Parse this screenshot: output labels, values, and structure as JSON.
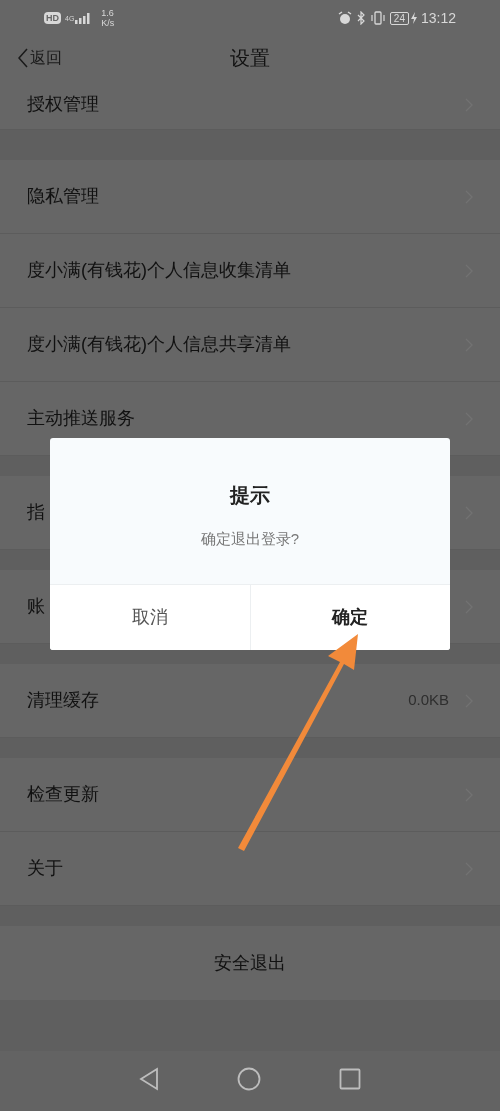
{
  "status_bar": {
    "hd": "HD",
    "network": "4G",
    "speed": [
      "1.6",
      "K/s"
    ],
    "battery": "24",
    "time": "13:12"
  },
  "header": {
    "back": "返回",
    "title": "设置"
  },
  "sections": [
    {
      "rows": [
        {
          "label": "授权管理"
        }
      ]
    },
    {
      "rows": [
        {
          "label": "隐私管理"
        },
        {
          "label": "度小满(有钱花)个人信息收集清单"
        },
        {
          "label": "度小满(有钱花)个人信息共享清单"
        },
        {
          "label": "主动推送服务"
        }
      ]
    },
    {
      "rows": [
        {
          "label": "指"
        }
      ]
    },
    {
      "rows": [
        {
          "label": "账"
        }
      ]
    },
    {
      "rows": [
        {
          "label": "清理缓存",
          "value": "0.0KB"
        }
      ]
    },
    {
      "rows": [
        {
          "label": "检查更新"
        },
        {
          "label": "关于"
        }
      ]
    }
  ],
  "logout": "安全退出",
  "dialog": {
    "title": "提示",
    "message": "确定退出登录?",
    "buttons": [
      {
        "label": "取消",
        "kind": "cancel"
      },
      {
        "label": "确定",
        "kind": "confirm"
      }
    ]
  }
}
